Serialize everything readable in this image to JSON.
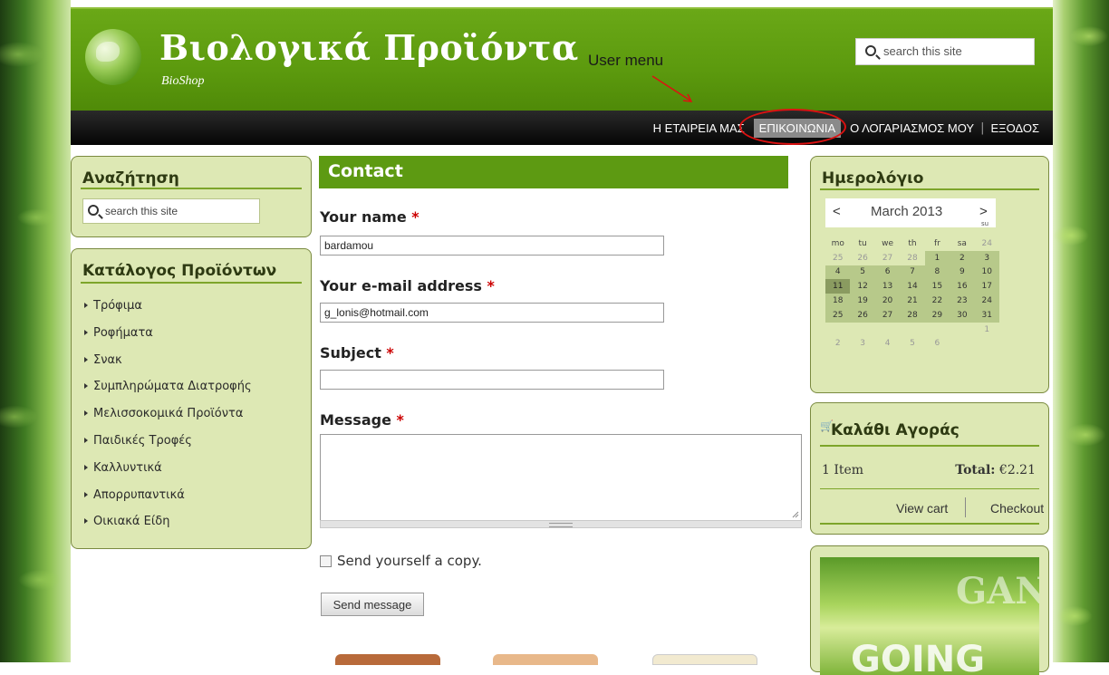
{
  "header": {
    "site_title": "Βιολογικά Προϊόντα",
    "site_slogan": "BioShop",
    "annotation": "User menu",
    "search_placeholder": "search this site"
  },
  "user_menu": {
    "items": [
      "Η ΕΤΑΙΡΕΙΑ ΜΑΣ",
      "ΕΠΙΚΟΙΝΩΝΙΑ",
      "Ο ΛΟΓΑΡΙΑΣΜΟΣ ΜΟΥ",
      "ΕΞΟΔΟΣ"
    ],
    "active": "ΕΠΙΚΟΙΝΩΝΙΑ",
    "highlight_color": "#dd1111"
  },
  "sidebar_left": {
    "search_title": "Αναζήτηση",
    "search_placeholder": "search this site",
    "catalog_title": "Κατάλογος Προϊόντων",
    "catalog_items": [
      "Τρόφιμα",
      "Ροφήματα",
      "Σνακ",
      "Συμπληρώματα Διατροφής",
      "Μελισσοκομικά Προϊόντα",
      "Παιδικές Τροφές",
      "Καλλυντικά",
      "Απορρυπαντικά",
      "Οικιακά Είδη"
    ]
  },
  "contact_form": {
    "title": "Contact",
    "name_label": "Your name",
    "name_value": "bardamou",
    "email_label": "Your e-mail address",
    "email_value": "g_lonis@hotmail.com",
    "subject_label": "Subject",
    "subject_value": "",
    "message_label": "Message",
    "required_mark": "*",
    "copy_label": "Send yourself a copy.",
    "copy_checked": false,
    "submit_label": "Send message"
  },
  "calendar": {
    "title": "Ημερολόγιο",
    "month": "March 2013",
    "prev": "<",
    "next": ">",
    "sun_header": "su",
    "weekdays": [
      "mo",
      "tu",
      "we",
      "th",
      "fr",
      "sa",
      "24"
    ],
    "weeks": [
      [
        "25",
        "26",
        "27",
        "28",
        "1",
        "2",
        "3"
      ],
      [
        "4",
        "5",
        "6",
        "7",
        "8",
        "9",
        "10"
      ],
      [
        "11",
        "12",
        "13",
        "14",
        "15",
        "16",
        "17"
      ],
      [
        "18",
        "19",
        "20",
        "21",
        "22",
        "23",
        "24"
      ],
      [
        "25",
        "26",
        "27",
        "28",
        "29",
        "30",
        "31"
      ],
      [
        "",
        "",
        "",
        "",
        "",
        "",
        "1"
      ],
      [
        "2",
        "3",
        "4",
        "5",
        "6",
        "",
        ""
      ]
    ],
    "today": "11"
  },
  "cart": {
    "title": "Καλάθι Αγοράς",
    "item_count": "1 Item",
    "total_label": "Total:",
    "total_value": "€2.21",
    "view_cart": "View cart",
    "checkout": "Checkout"
  },
  "ad": {
    "text_top": "GANIC",
    "text_bottom": "GOING"
  },
  "colors": {
    "header_green": "#5c9a0e",
    "block_bg": "#dde8b4",
    "accent_rule": "#7da52a",
    "required": "#cc0000"
  }
}
